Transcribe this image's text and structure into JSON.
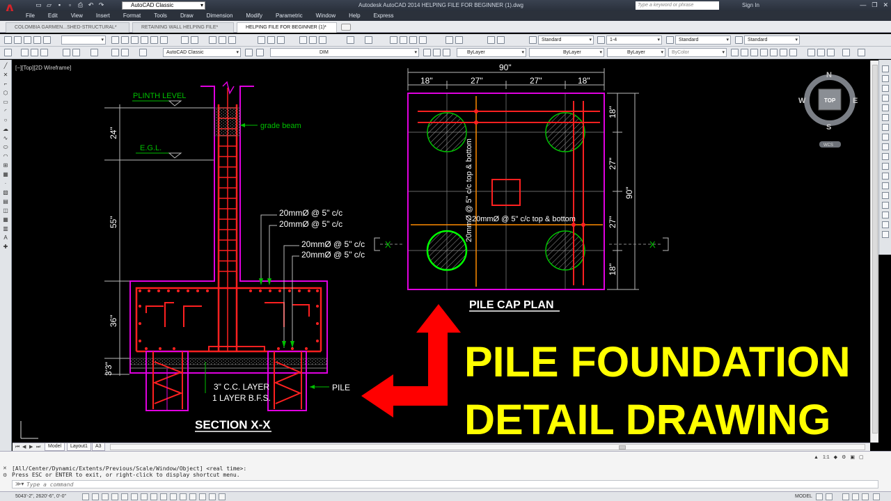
{
  "window": {
    "workspace": "AutoCAD Classic",
    "title": "Autodesk AutoCAD 2014    HELPING FILE FOR BEGINNER (1).dwg",
    "search_placeholder": "Type a keyword or phrase",
    "signin": "Sign In"
  },
  "menu": [
    "File",
    "Edit",
    "View",
    "Insert",
    "Format",
    "Tools",
    "Draw",
    "Dimension",
    "Modify",
    "Parametric",
    "Window",
    "Help",
    "Express"
  ],
  "doc_tabs": [
    {
      "label": "COLOMBIA GARMEN...SHED-STRUCTURAL*",
      "active": false
    },
    {
      "label": "RETAINING WALL HELPING FILE*",
      "active": false
    },
    {
      "label": "HELPING FILE FOR BEGINNER (1)*",
      "active": true
    }
  ],
  "toolbar1": {
    "text_style": "Standard",
    "dim_scale": "1-4",
    "dim_style": "Standard",
    "table_style": "Standard"
  },
  "toolbar2": {
    "workspace": "AutoCAD Classic",
    "layer": "DIM",
    "color": "ByLayer",
    "linetype": "ByLayer",
    "lineweight": "ByLayer",
    "plotstyle": "ByColor"
  },
  "viewport": {
    "label": "[−][Top][2D Wireframe]"
  },
  "viewcube": {
    "north": "N",
    "south": "S",
    "east": "E",
    "west": "W",
    "top": "TOP",
    "wcs": "WCS"
  },
  "section": {
    "plinth_level": "PLINTH LEVEL",
    "egl": "E.G.L.",
    "grade_beam": "grade beam",
    "bar1": "20mmØ @ 5\" c/c",
    "bar2": "20mmØ @ 5\" c/c",
    "bar3": "20mmØ @ 5\" c/c",
    "bar4": "20mmØ @ 5\" c/c",
    "dims": [
      "24\"",
      "55\"",
      "36\"",
      "3'3\""
    ],
    "cc_layer": "3\" C.C. LAYER",
    "bfs_layer": "1 LAYER B.F.S.",
    "pile": "PILE",
    "title": "SECTION X-X"
  },
  "plan": {
    "top_total": "90\"",
    "top_dims": [
      "18\"",
      "27\"",
      "27\"",
      "18\""
    ],
    "right_dims": [
      "18\"",
      "27\"",
      "27\"",
      "18\""
    ],
    "right_total": "90\"",
    "bar_horizontal": "20mmØ @ 5\" c/c top & bottom",
    "bar_vertical": "20mmØ @ 5\" c/c top & bottom",
    "section_mark": "X",
    "title": "PILE CAP PLAN"
  },
  "headline": {
    "line1": "PILE FOUNDATION",
    "line2": "DETAIL DRAWING",
    "color": "#ffff00"
  },
  "layout_tabs": [
    "Model",
    "Layout1",
    "A3"
  ],
  "command": {
    "history1": "[All/Center/Dynamic/Extents/Previous/Scale/Window/Object] <real time>:",
    "history2": "Press ESC or ENTER to exit, or right-click to display shortcut menu.",
    "placeholder": "Type a command",
    "scale": "1:1"
  },
  "status": {
    "coords": "5043'-2\",  2620'-6\",  0'-0\"",
    "model": "MODEL"
  }
}
